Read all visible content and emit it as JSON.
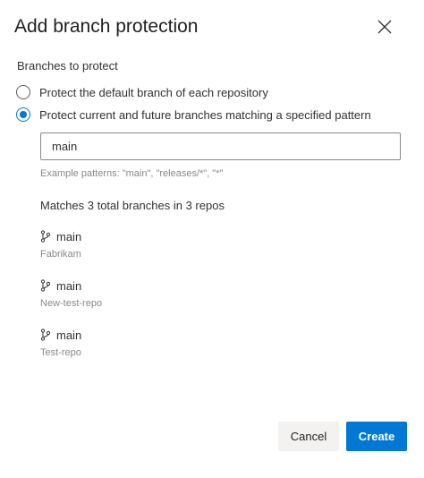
{
  "dialog": {
    "title": "Add branch protection",
    "close_icon": "close-icon"
  },
  "branches_section": {
    "label": "Branches to protect",
    "options": [
      {
        "label": "Protect the default branch of each repository",
        "checked": false
      },
      {
        "label": "Protect current and future branches matching a specified pattern",
        "checked": true
      }
    ],
    "pattern_value": "main",
    "hint": "Example patterns: \"main\", \"releases/*\", \"*\"",
    "matches_summary": "Matches 3 total branches in 3 repos",
    "branch_icon": "branch-icon",
    "matched_branches": [
      {
        "branch": "main",
        "repo": "Fabrikam"
      },
      {
        "branch": "main",
        "repo": "New-test-repo"
      },
      {
        "branch": "main",
        "repo": "Test-repo"
      }
    ]
  },
  "footer": {
    "cancel_label": "Cancel",
    "create_label": "Create"
  },
  "colors": {
    "accent": "#0078d4",
    "secondary_button": "#f3f2f1",
    "muted_text": "#8a8886"
  }
}
